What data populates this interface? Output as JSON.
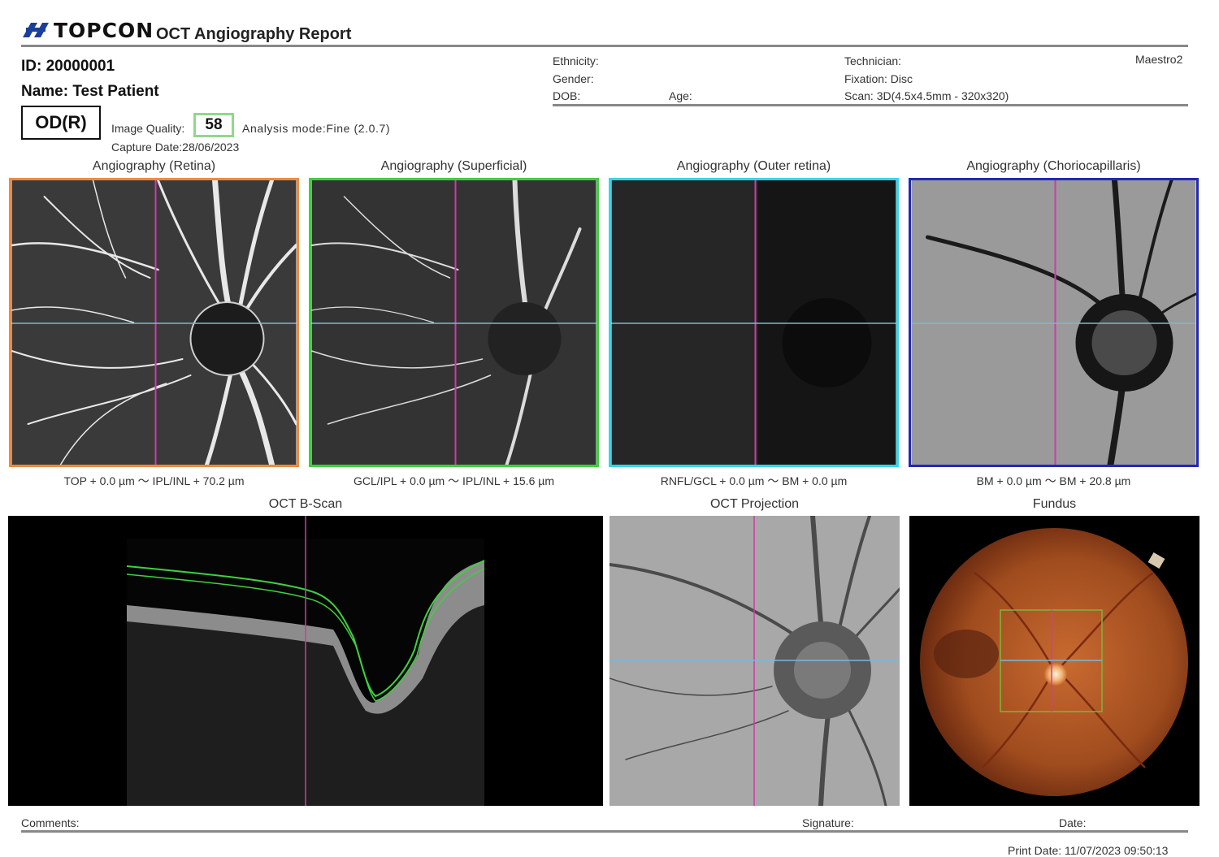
{
  "header": {
    "brand": "TOPCON",
    "report_title": "OCT Angiography Report",
    "device": "Maestro2"
  },
  "patient": {
    "id_label": "ID: 20000001",
    "name_label": "Name: Test Patient",
    "eye": "OD(R)"
  },
  "meta": {
    "ethnicity": "Ethnicity:",
    "gender": "Gender:",
    "dob": "DOB:",
    "age": "Age:",
    "technician": "Technician:",
    "fixation": "Fixation: Disc",
    "scan": "Scan: 3D(4.5x4.5mm - 320x320)"
  },
  "quality": {
    "label": "Image Quality:",
    "value": "58",
    "analysis_mode": "Analysis mode:Fine (2.0.7)",
    "capture_date": "Capture Date:28/06/2023"
  },
  "angiography_panels": [
    {
      "title": "Angiography (Retina)",
      "range": "TOP + 0.0 µm ～ IPL/INL + 70.2 µm",
      "border_color": "#f08a3c"
    },
    {
      "title": "Angiography (Superficial)",
      "range": "GCL/IPL + 0.0 µm ～ IPL/INL + 15.6 µm",
      "border_color": "#3ed13e"
    },
    {
      "title": "Angiography (Outer retina)",
      "range": "RNFL/GCL + 0.0 µm ～ BM + 0.0 µm",
      "border_color": "#37d6e8"
    },
    {
      "title": "Angiography (Choriocapillaris)",
      "range": "BM + 0.0 µm ～ BM + 20.8 µm",
      "border_color": "#2228b8"
    }
  ],
  "bottom_panels": {
    "bscan_title": "OCT B-Scan",
    "projection_title": "OCT Projection",
    "fundus_title": "Fundus"
  },
  "footer": {
    "comments": "Comments:",
    "signature": "Signature:",
    "date": "Date:",
    "print_date": "Print Date: 11/07/2023 09:50:13"
  },
  "colors": {
    "crosshair_vertical": "#d03aa8",
    "crosshair_horizontal": "#7ab8d8",
    "segmentation": "#3ed13e"
  }
}
